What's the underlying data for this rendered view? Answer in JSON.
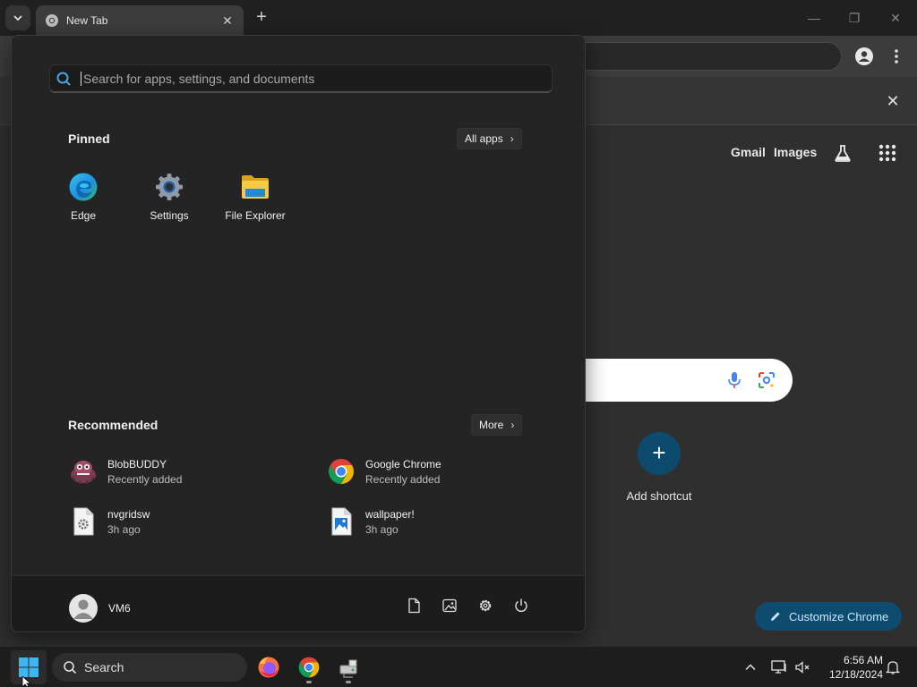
{
  "browser": {
    "tab_title": "New Tab",
    "tab_favicon": "chrome-icon",
    "window_controls": [
      "minimize",
      "restore",
      "close"
    ]
  },
  "new_tab_page": {
    "links": {
      "gmail": "Gmail",
      "images": "Images"
    },
    "add_shortcut_label": "Add shortcut",
    "customize_label": "Customize Chrome",
    "accent_color": "#0d4b6f"
  },
  "start_menu": {
    "search_placeholder": "Search for apps, settings, and documents",
    "pinned": {
      "title": "Pinned",
      "all_apps_label": "All apps",
      "apps": [
        {
          "label": "Edge",
          "icon": "edge-icon"
        },
        {
          "label": "Settings",
          "icon": "settings-gear-icon"
        },
        {
          "label": "File Explorer",
          "icon": "folder-icon"
        }
      ]
    },
    "recommended": {
      "title": "Recommended",
      "more_label": "More",
      "items": [
        {
          "name": "BlobBUDDY",
          "sub": "Recently added",
          "icon": "blobbuddy-icon"
        },
        {
          "name": "Google Chrome",
          "sub": "Recently added",
          "icon": "chrome-icon"
        },
        {
          "name": "nvgridsw",
          "sub": "3h ago",
          "icon": "settings-file-icon"
        },
        {
          "name": "wallpaper!",
          "sub": "3h ago",
          "icon": "image-file-icon"
        }
      ]
    },
    "user": {
      "name": "VM6"
    },
    "footer_icons": [
      "documents-icon",
      "pictures-icon",
      "settings-icon",
      "power-icon"
    ]
  },
  "taskbar": {
    "search_label": "Search",
    "apps": [
      "firefox-icon",
      "chrome-icon",
      "network-drive-icon"
    ],
    "clock": {
      "time": "6:56 AM",
      "date": "12/18/2024"
    }
  }
}
